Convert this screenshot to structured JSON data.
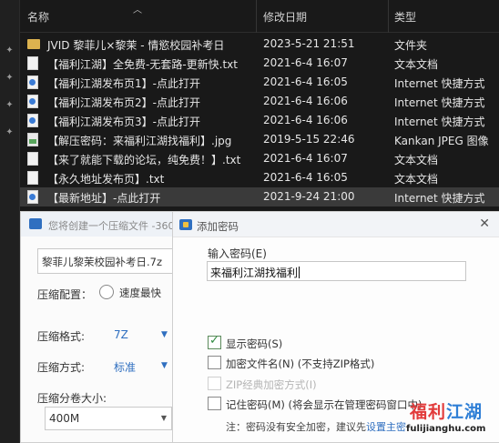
{
  "explorer": {
    "columns": {
      "name": "名称",
      "date": "修改日期",
      "type": "类型"
    },
    "files": [
      {
        "icon": "folder",
        "name": "JVID 黎菲儿×黎茉 - 情慾校园补考日",
        "date": "2023-5-21 21:51",
        "type": "文件夹"
      },
      {
        "icon": "txt",
        "name": "【福利江湖】全免费-无套路-更新快.txt",
        "date": "2021-6-4 16:07",
        "type": "文本文档"
      },
      {
        "icon": "url",
        "name": "【福利江湖发布页1】-点此打开",
        "date": "2021-6-4 16:05",
        "type": "Internet 快捷方式"
      },
      {
        "icon": "url",
        "name": "【福利江湖发布页2】-点此打开",
        "date": "2021-6-4 16:06",
        "type": "Internet 快捷方式"
      },
      {
        "icon": "url",
        "name": "【福利江湖发布页3】-点此打开",
        "date": "2021-6-4 16:06",
        "type": "Internet 快捷方式"
      },
      {
        "icon": "jpg",
        "name": "【解压密码：来福利江湖找福利】.jpg",
        "date": "2019-5-15 22:46",
        "type": "Kankan JPEG 图像"
      },
      {
        "icon": "txt",
        "name": "【来了就能下载的论坛，纯免费！】.txt",
        "date": "2021-6-4 16:07",
        "type": "文本文档"
      },
      {
        "icon": "txt",
        "name": "【永久地址发布页】.txt",
        "date": "2021-6-4 16:05",
        "type": "文本文档"
      },
      {
        "icon": "url",
        "name": "【最新地址】-点此打开",
        "date": "2021-9-24 21:00",
        "type": "Internet 快捷方式"
      }
    ]
  },
  "zip": {
    "title": "您将创建一个压缩文件 -360",
    "filename": "黎菲儿黎茉校园补考日.7z",
    "config_label": "压缩配置：",
    "speed_option": "速度最快",
    "format_label": "压缩格式:",
    "format_value": "7Z",
    "method_label": "压缩方式:",
    "method_value": "标准",
    "split_label": "压缩分卷大小:",
    "split_value": "400M"
  },
  "password_dialog": {
    "title": "添加密码",
    "input_label": "输入密码(E)",
    "password_value": "来福利江湖找福利",
    "options": [
      {
        "label": "显示密码(S)",
        "checked": true,
        "disabled": false
      },
      {
        "label": "加密文件名(N) (不支持ZIP格式)",
        "checked": false,
        "disabled": false
      },
      {
        "label": "ZIP经典加密方式(I)",
        "checked": false,
        "disabled": true
      },
      {
        "label": "记住密码(M) (将会显示在管理密码窗口中)",
        "checked": false,
        "disabled": false
      }
    ],
    "note_text": "注：密码没有安全加密，建议先",
    "note_link": "设置主密"
  },
  "watermark": {
    "part1": "福利",
    "part2": "江湖",
    "url": "fulijianghu.com"
  }
}
